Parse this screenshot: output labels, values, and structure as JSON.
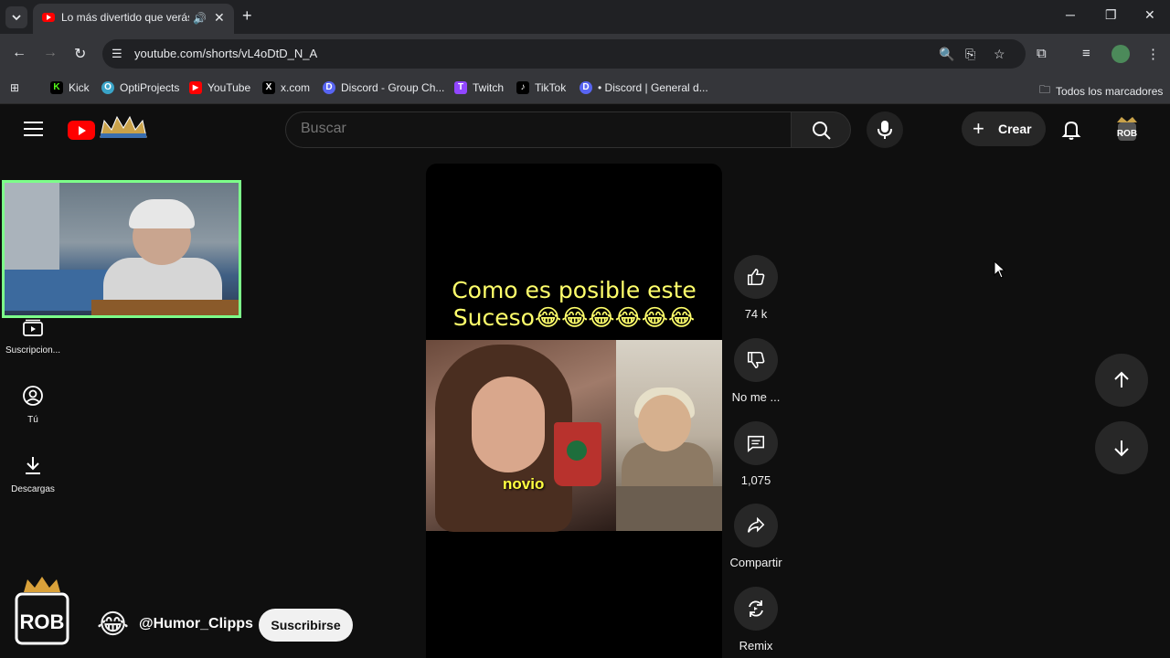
{
  "browser": {
    "tab_title": "Lo más divertido que verás",
    "address": "youtube.com/shorts/vL4oDtD_N_A",
    "bookmarks": [
      {
        "label": "Kick",
        "color": "#53fc18",
        "letter": "K"
      },
      {
        "label": "OptiProjects",
        "color": "#3aa4c8",
        "letter": "O"
      },
      {
        "label": "YouTube",
        "color": "#ff0000",
        "letter": "▶"
      },
      {
        "label": "x.com",
        "color": "#000000",
        "letter": "X"
      },
      {
        "label": "Discord - Group Ch...",
        "color": "#5865f2",
        "letter": "D"
      },
      {
        "label": "Twitch",
        "color": "#9146ff",
        "letter": "T"
      },
      {
        "label": "TikTok",
        "color": "#000000",
        "letter": "♪"
      },
      {
        "label": "• Discord | General d...",
        "color": "#5865f2",
        "letter": "D"
      }
    ],
    "all_bookmarks": "Todos los marcadores"
  },
  "youtube": {
    "search_placeholder": "Buscar",
    "create_label": "Crear",
    "sidebar": [
      {
        "label": "Suscripcion..."
      },
      {
        "label": "Tú"
      },
      {
        "label": "Descargas"
      }
    ]
  },
  "short": {
    "caption_line1": "Como es posible este",
    "caption_line2": "Suceso😂😂😂😂😂😂",
    "overlay_text": "novio",
    "actions": {
      "like": "74 k",
      "dislike": "No me ...",
      "comments": "1,075",
      "share": "Compartir",
      "remix": "Remix"
    },
    "channel_emoji": "😂",
    "channel_name": "@Humor_Clipps",
    "subscribe": "Suscribirse"
  }
}
